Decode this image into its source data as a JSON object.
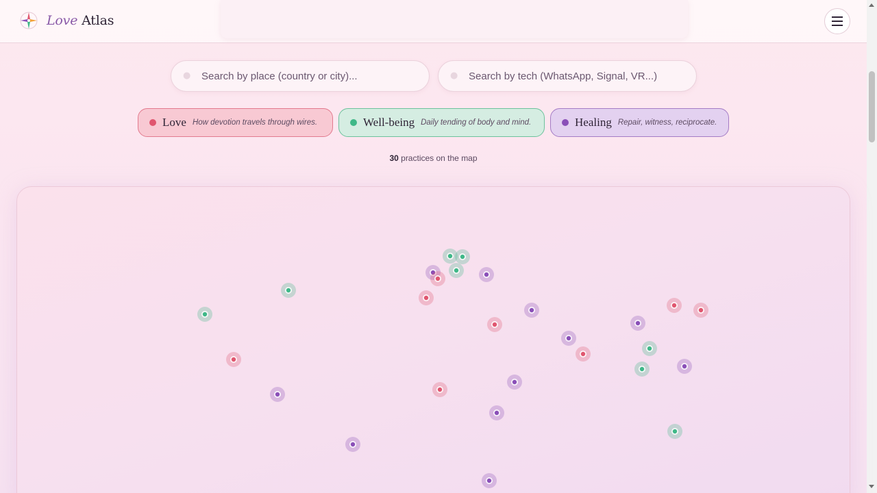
{
  "brand": {
    "accent": "Love",
    "rest": "Atlas"
  },
  "search": {
    "place_placeholder": "Search by place (country or city)...",
    "tech_placeholder": "Search by tech (WhatsApp, Signal, VR...)"
  },
  "filters": [
    {
      "name": "Love",
      "description": "How devotion travels through wires.",
      "color": "#e0566f"
    },
    {
      "name": "Well-being",
      "description": "Daily tending of body and mind.",
      "color": "#3fb888"
    },
    {
      "name": "Healing",
      "description": "Repair, witness, reciprocate.",
      "color": "#8a4fb8"
    }
  ],
  "summary": {
    "count": "30",
    "suffix": "practices on the map"
  },
  "icons": {
    "logo": "compass-star-icon",
    "menu": "hamburger-menu-icon"
  },
  "colors": {
    "love": "#e0566f",
    "wellbeing": "#3fb888",
    "healing": "#8a4fb8"
  },
  "markers": [
    {
      "category": "wellbeing"
    },
    {
      "category": "wellbeing"
    },
    {
      "category": "healing"
    },
    {
      "category": "love"
    },
    {
      "category": "wellbeing"
    },
    {
      "category": "healing"
    },
    {
      "category": "wellbeing"
    },
    {
      "category": "love"
    },
    {
      "category": "love"
    },
    {
      "category": "healing"
    },
    {
      "category": "wellbeing"
    },
    {
      "category": "love"
    },
    {
      "category": "love"
    },
    {
      "category": "healing"
    },
    {
      "category": "love"
    },
    {
      "category": "healing"
    },
    {
      "category": "healing"
    },
    {
      "category": "love"
    },
    {
      "category": "wellbeing"
    },
    {
      "category": "healing"
    },
    {
      "category": "wellbeing"
    },
    {
      "category": "healing"
    },
    {
      "category": "healing"
    },
    {
      "category": "wellbeing"
    },
    {
      "category": "healing"
    },
    {
      "category": "love"
    },
    {
      "category": "healing"
    }
  ]
}
